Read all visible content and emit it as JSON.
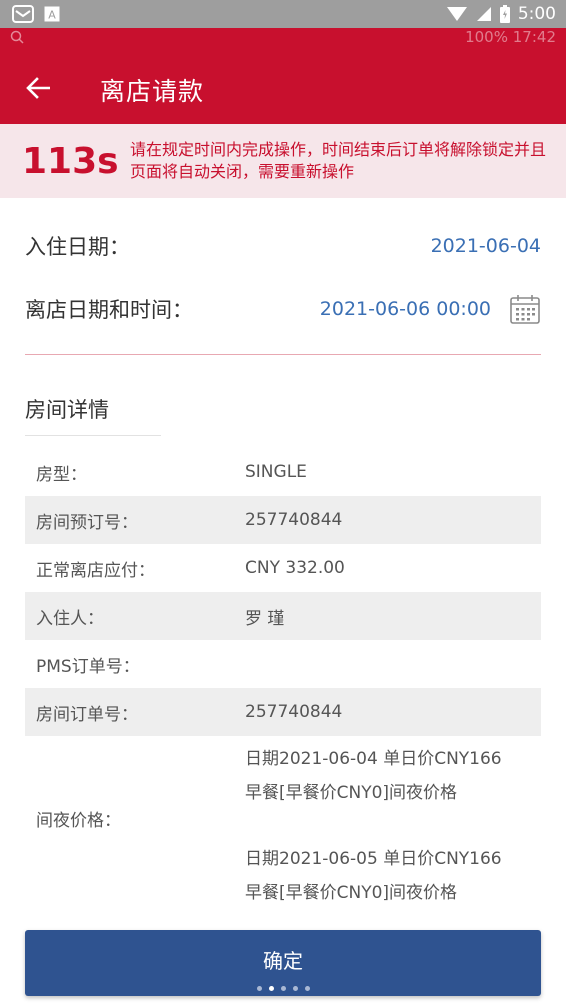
{
  "status_bar": {
    "time": "5:00",
    "icons": [
      "mail-notification-icon",
      "text-input-icon",
      "wifi-icon",
      "cell-signal-icon",
      "battery-icon"
    ]
  },
  "ghost_status": {
    "time": "17:42",
    "battery": "100%"
  },
  "header": {
    "title": "离店请款",
    "back_icon": "arrow-left-icon",
    "background": "#c8102e"
  },
  "countdown": {
    "seconds": "113s",
    "message": "请在规定时间内完成操作，时间结束后订单将解除锁定并且页面将自动关闭，需要重新操作"
  },
  "dates": {
    "checkin_label": "入住日期：",
    "checkin_value": "2021-06-04",
    "checkout_label": "离店日期和时间：",
    "checkout_value": "2021-06-06 00:00",
    "calendar_icon": "calendar-icon"
  },
  "room_details": {
    "title": "房间详情",
    "rows": [
      {
        "label": "房型：",
        "value": "SINGLE"
      },
      {
        "label": "房间预订号：",
        "value": "257740844"
      },
      {
        "label": "正常离店应付：",
        "value": "CNY 332.00"
      },
      {
        "label": "入住人：",
        "value": "罗 瑾"
      },
      {
        "label": "PMS订单号：",
        "value": ""
      },
      {
        "label": "房间订单号：",
        "value": "257740844"
      }
    ],
    "night_price": {
      "label": "间夜价格：",
      "entries": [
        {
          "line1": "日期2021-06-04 单日价CNY166",
          "line2": "早餐[早餐价CNY0]间夜价格"
        },
        {
          "line1": "日期2021-06-05 单日价CNY166",
          "line2": "早餐[早餐价CNY0]间夜价格"
        }
      ]
    }
  },
  "confirm_button": {
    "label": "确定",
    "color": "#2f5390"
  },
  "page_indicator": {
    "count": 5,
    "active_index": 1
  }
}
